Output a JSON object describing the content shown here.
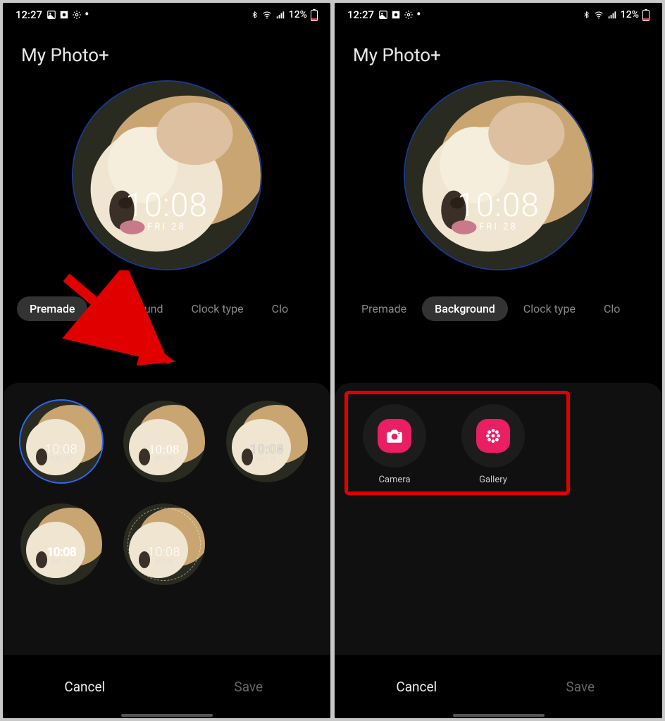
{
  "status": {
    "time": "12:27",
    "battery_text": "12%",
    "icons_left": [
      "image-icon",
      "target-icon",
      "gear-icon"
    ],
    "icons_right": [
      "bluetooth-icon",
      "wifi-icon",
      "signal-icon"
    ]
  },
  "title": "My Photo+",
  "watch": {
    "time": "10:08",
    "date": "FRI 28"
  },
  "tabs": [
    "Premade",
    "Background",
    "Clock type",
    "Clock color"
  ],
  "tabs_overflow": "Clo",
  "premade": {
    "time": "10:08",
    "date": "SAT 28"
  },
  "bg_options": {
    "camera": "Camera",
    "gallery": "Gallery"
  },
  "footer": {
    "cancel": "Cancel",
    "save": "Save"
  }
}
